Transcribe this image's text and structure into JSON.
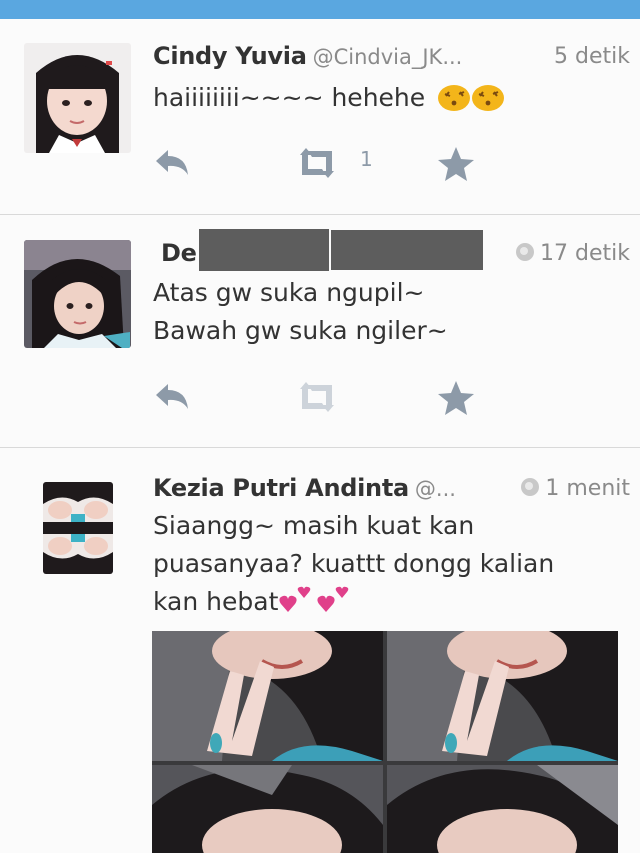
{
  "tweets": [
    {
      "name": "Cindy Yuvia",
      "handle": "@Cindvia_JK...",
      "time": "5 detik",
      "text_lines": [
        "haiiiiiiii~~~~ hehehe"
      ],
      "emoji_icons": [
        "kissing-face-icon",
        "kissing-face-icon"
      ],
      "retweet_count": "1"
    },
    {
      "name": "De",
      "handle": "",
      "time": "17 detik",
      "text_lines": [
        "Atas gw suka ngupil~",
        "Bawah gw suka ngiler~"
      ],
      "retweet_count": ""
    },
    {
      "name": "Kezia Putri Andinta",
      "handle": "@...",
      "time": "1 menit",
      "text_lines": [
        "Siaangg~ masih kuat kan",
        "puasanyaa? kuattt dongg kalian",
        "kan hebat"
      ],
      "emoji_icons": [
        "two-hearts-icon",
        "two-hearts-icon"
      ]
    }
  ],
  "colors": {
    "topbar": "#5aa7e0",
    "action_icon": "#8d9aa8",
    "meta_text": "#8a8a8a",
    "heart_emoji": "#e0408a",
    "face_emoji": "#f3b51a"
  }
}
